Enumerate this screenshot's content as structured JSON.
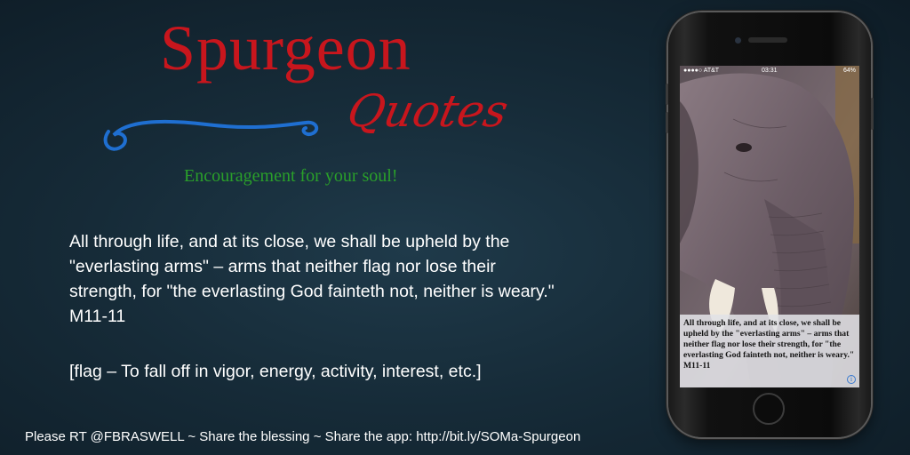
{
  "header": {
    "title": "Spurgeon",
    "script_title": "Quotes",
    "tagline": "Encouragement for your soul!"
  },
  "quote": {
    "text": "All through life, and at its close, we shall be upheld by the \"everlasting arms\" – arms that neither flag nor lose their strength, for \"the everlasting God fainteth not, neither is weary.\" M11-11",
    "definition": "[flag – To fall off in vigor, energy, activity, interest, etc.]"
  },
  "footer": {
    "text": "Please RT @FBRASWELL ~ Share the blessing ~ Share the app: http://bit.ly/SOMa-Spurgeon"
  },
  "phone": {
    "status": {
      "carrier": "●●●●○ AT&T",
      "time": "03:31",
      "battery": "64%"
    },
    "caption": "All through life, and at its close, we shall be upheld by the \"everlasting arms\" – arms that neither flag nor lose their strength, for \"the everlasting God fainteth not, neither is weary.\" M11-11",
    "info_icon": "info-icon"
  },
  "colors": {
    "title": "#c8161d",
    "tagline": "#2aa02a",
    "swirl": "#1f6fd1",
    "background": "#162b38"
  }
}
